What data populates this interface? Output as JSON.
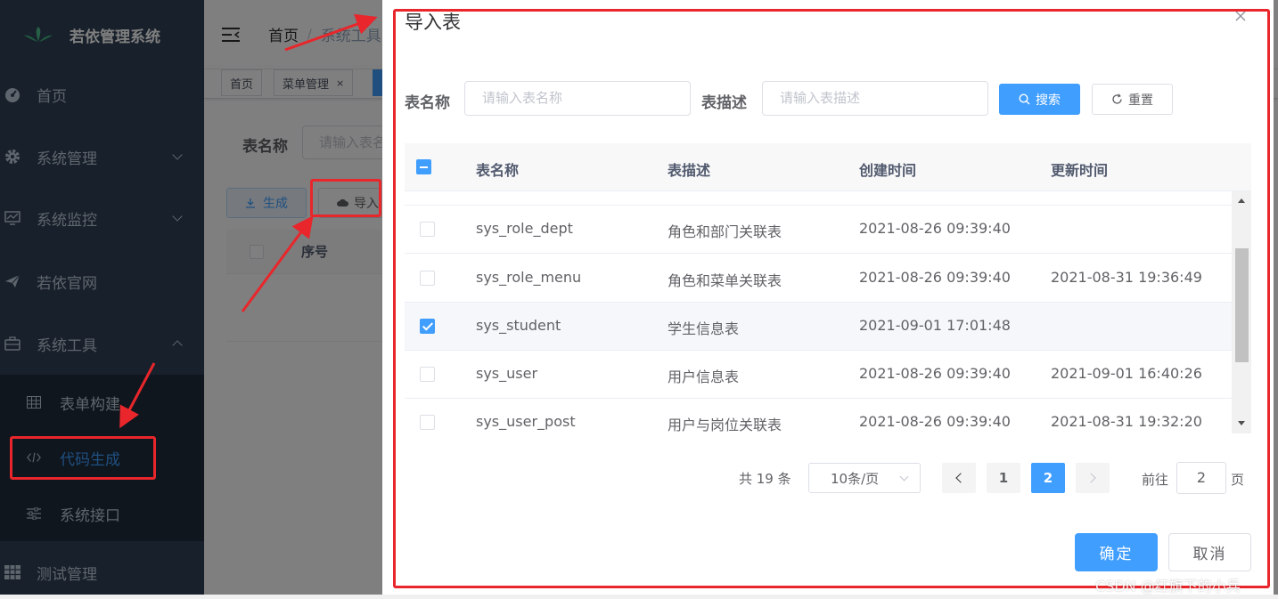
{
  "app": {
    "title": "若依管理系统"
  },
  "sidebar": {
    "items": [
      {
        "label": "首页",
        "icon": "dashboard-icon"
      },
      {
        "label": "系统管理",
        "icon": "gear-icon"
      },
      {
        "label": "系统监控",
        "icon": "monitor-icon"
      },
      {
        "label": "若依官网",
        "icon": "send-icon"
      },
      {
        "label": "系统工具",
        "icon": "toolbox-icon"
      },
      {
        "label": "测试管理",
        "icon": "grid-icon"
      }
    ],
    "submenu": [
      {
        "label": "表单构建",
        "icon": "table-icon"
      },
      {
        "label": "代码生成",
        "icon": "code-icon"
      },
      {
        "label": "系统接口",
        "icon": "sliders-icon"
      }
    ]
  },
  "navbar": {
    "breadcrumb_home": "首页",
    "breadcrumb_sep": "/",
    "breadcrumb_current": "系统工具"
  },
  "tags": [
    {
      "label": "首页"
    },
    {
      "label": "菜单管理",
      "close": "×"
    }
  ],
  "background_page": {
    "query_label": "表名称",
    "query_placeholder": "请输入表名称",
    "generate_label": "生成",
    "import_label": "导入",
    "col_index": "序号"
  },
  "dialog": {
    "title": "导入表",
    "table_name_label": "表名称",
    "table_name_placeholder": "请输入表名称",
    "table_desc_label": "表描述",
    "table_desc_placeholder": "请输入表描述",
    "search_label": "搜索",
    "reset_label": "重置",
    "columns": [
      "表名称",
      "表描述",
      "创建时间",
      "更新时间"
    ],
    "rows": [
      {
        "checked": false,
        "name": "sys_role_dept",
        "desc": "角色和部门关联表",
        "created": "2021-08-26 09:39:40",
        "updated": ""
      },
      {
        "checked": false,
        "name": "sys_role_menu",
        "desc": "角色和菜单关联表",
        "created": "2021-08-26 09:39:40",
        "updated": "2021-08-31 19:36:49"
      },
      {
        "checked": true,
        "name": "sys_student",
        "desc": "学生信息表",
        "created": "2021-09-01 17:01:48",
        "updated": ""
      },
      {
        "checked": false,
        "name": "sys_user",
        "desc": "用户信息表",
        "created": "2021-08-26 09:39:40",
        "updated": "2021-09-01 16:40:26"
      },
      {
        "checked": false,
        "name": "sys_user_post",
        "desc": "用户与岗位关联表",
        "created": "2021-08-26 09:39:40",
        "updated": "2021-08-31 19:32:20"
      }
    ],
    "pagination": {
      "total_text": "共 19 条",
      "page_size": "10条/页",
      "pages": [
        "1",
        "2"
      ],
      "current_page": 2,
      "goto_label": "前往",
      "goto_value": "2",
      "goto_unit": "页"
    },
    "confirm_label": "确定",
    "cancel_label": "取消"
  },
  "watermark": "CSDN @红旗下的小兵",
  "colors": {
    "primary": "#409eff",
    "sidebar": "#304156",
    "submenu": "#1f2d3d",
    "annotation": "#e8262b"
  }
}
